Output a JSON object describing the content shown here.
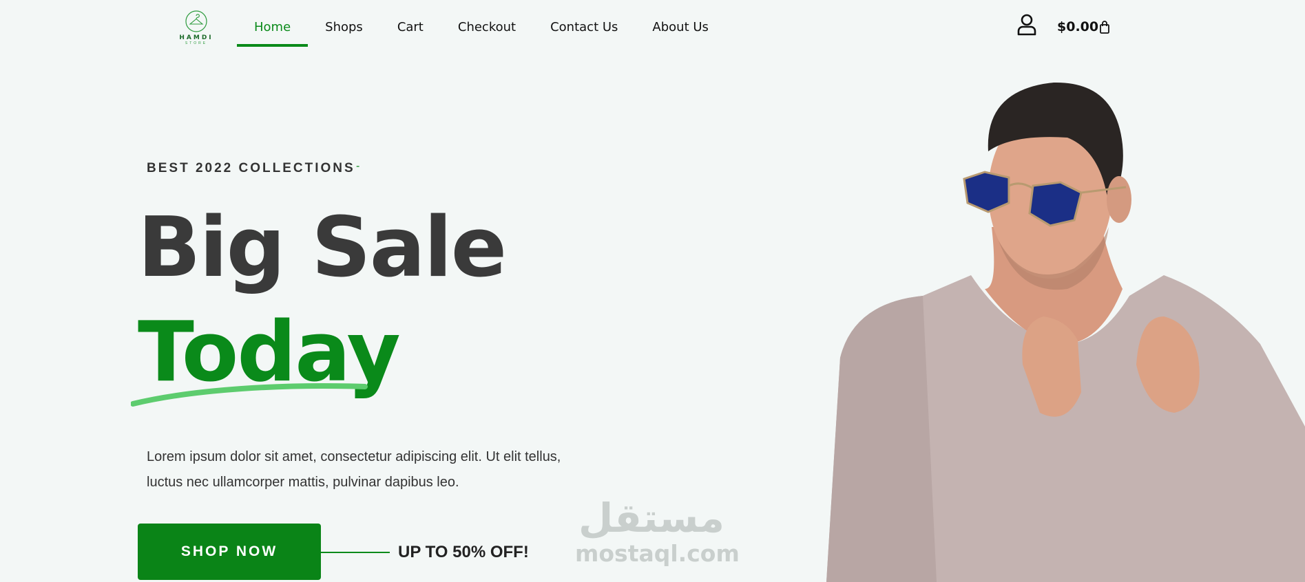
{
  "header": {
    "logo": {
      "brand": "HAMDI",
      "sub": "STORE",
      "icon": "hanger-icon"
    },
    "nav": [
      {
        "label": "Home",
        "active": true
      },
      {
        "label": "Shops",
        "active": false
      },
      {
        "label": "Cart",
        "active": false
      },
      {
        "label": "Checkout",
        "active": false
      },
      {
        "label": "Contact Us",
        "active": false
      },
      {
        "label": "About Us",
        "active": false
      }
    ],
    "user_icon": "user-icon",
    "cart_total": "$0.00",
    "cart_icon": "shopping-bag-icon"
  },
  "hero": {
    "eyebrow": "BEST 2022 COLLECTIONS",
    "eyebrow_dash": "-",
    "headline_line1": "Big Sale",
    "headline_line2": "Today",
    "description": "Lorem ipsum dolor sit amet, consectetur adipiscing elit. Ut elit tellus, luctus nec ullamcorper mattis, pulvinar dapibus leo.",
    "cta_label": "SHOP NOW",
    "promo": "UP TO 50% OFF!"
  },
  "watermark": {
    "arabic": "مستقل",
    "latin": "mostaql.com"
  },
  "colors": {
    "accent": "#0a8a1a",
    "button": "#0a8417",
    "swoosh": "#5dcc6e",
    "background": "#f3f7f6",
    "text": "#333333"
  }
}
